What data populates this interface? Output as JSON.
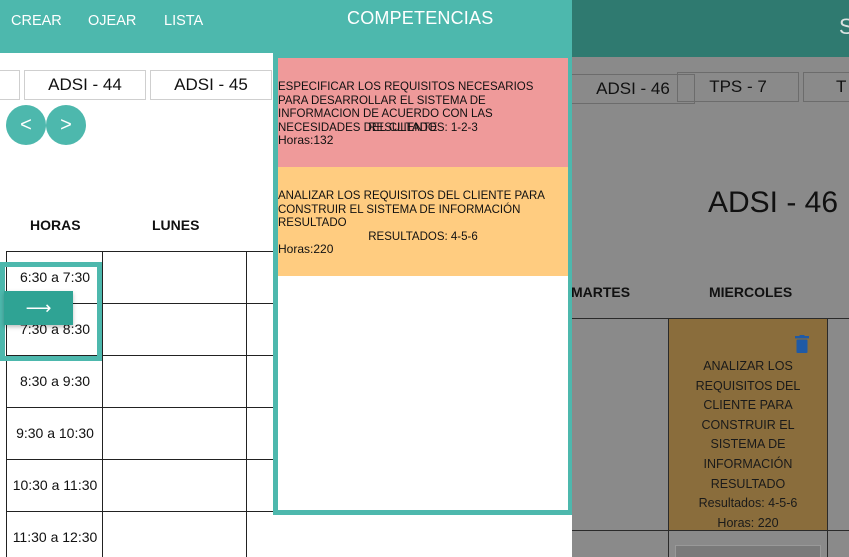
{
  "menu": {
    "crear": "CREAR",
    "ojear": "OJEAR",
    "lista": "LISTA"
  },
  "competencias_title": "COMPETENCIAS",
  "tabs": [
    "ADSI - 44",
    "ADSI - 45"
  ],
  "nav": {
    "prev": "<",
    "next": ">"
  },
  "schedule": {
    "headers": {
      "horas": "HORAS",
      "lunes": "LUNES"
    },
    "times": [
      "6:30 a 7:30",
      "7:30 a 8:30",
      "8:30 a 9:30",
      "9:30 a 10:30",
      "10:30 a 11:30",
      "11:30 a 12:30"
    ]
  },
  "arrow_label": "⟶",
  "competencias": [
    {
      "text": "ESPECIFICAR LOS REQUISITOS NECESARIOS PARA DESARROLLAR EL SISTEMA DE INFORMACION DE ACUERDO CON LAS NECESIDADES DEL CLIENTE",
      "resultados": "RESULTADOS: 1-2-3",
      "horas": "Horas:132",
      "color": "#ef9a9a"
    },
    {
      "text": "ANALIZAR LOS REQUISITOS DEL CLIENTE PARA CONSTRUIR EL SISTEMA DE INFORMACIÓN RESULTADO",
      "resultados": "RESULTADOS: 4-5-6",
      "horas": "Horas:220",
      "color": "#ffcc80"
    }
  ],
  "background": {
    "tabs": [
      "ADSI - 46",
      "TPS - 7",
      "T"
    ],
    "heading": "ADSI - 46",
    "col_martes": "MARTES",
    "col_miercoles": "MIERCOLES",
    "card": {
      "text": "ANALIZAR LOS REQUISITOS DEL CLIENTE PARA CONSTRUIR EL SISTEMA DE INFORMACIÓN RESULTADO",
      "resultados": "Resultados: 4-5-6",
      "horas": "Horas: 220"
    },
    "topbar_icon": "S"
  },
  "colors": {
    "accent": "#4db8ad",
    "accent_dark": "#2f7a70",
    "red_card": "#ef9a9a",
    "orange_card": "#ffcc80"
  }
}
